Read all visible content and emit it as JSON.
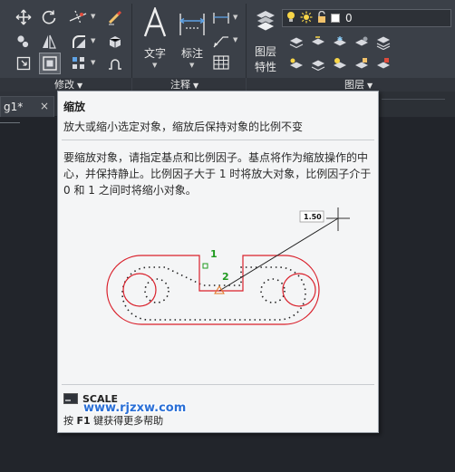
{
  "ribbon": {
    "text_button_label": "文字",
    "dimension_button_label": "标注",
    "layer_properties_label_line1": "图层",
    "layer_properties_label_line2": "特性",
    "panels": {
      "modify": "修改",
      "annotation": "注释",
      "layers": "图层"
    },
    "layer_combo_value": "0"
  },
  "document_tab": {
    "label": "g1*",
    "close_glyph": "×"
  },
  "tooltip": {
    "title": "缩放",
    "short_description": "放大或缩小选定对象，缩放后保持对象的比例不变",
    "long_description": "要缩放对象，请指定基点和比例因子。基点将作为缩放操作的中心，并保持静止。比例因子大于 1 时将放大对象，比例因子介于 0 和 1 之间时将缩小对象。",
    "illustration": {
      "scale_value": "1.50",
      "point_label_1": "1",
      "point_label_2": "2"
    },
    "command_name": "SCALE",
    "help_prefix": "按 ",
    "help_key": "F1",
    "help_suffix": " 键获得更多帮助",
    "watermark": "www.rjzxw.com"
  },
  "colors": {
    "ribbon_bg": "#3b4048",
    "canvas_bg": "#22252b",
    "tooltip_bg": "#f4f5f6",
    "illustration_red": "#d9202b",
    "illustration_green": "#1f9a1f"
  }
}
